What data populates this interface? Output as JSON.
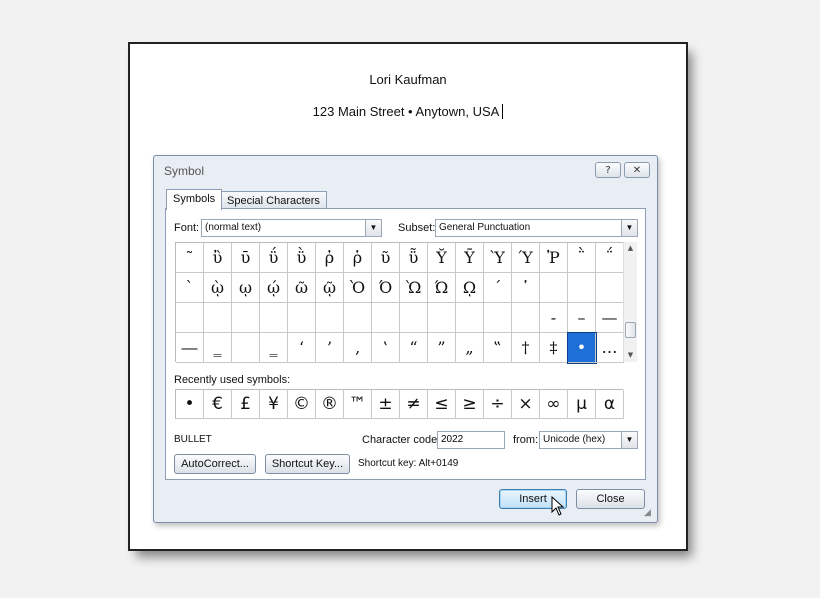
{
  "document": {
    "line1": "Lori Kaufman",
    "line2": "123 Main Street • Anytown, USA"
  },
  "dialog": {
    "title": "Symbol",
    "help_btn": "?",
    "close_btn": "✕",
    "tabs": [
      {
        "label": "Symbols",
        "active": true
      },
      {
        "label": "Special Characters",
        "active": false
      }
    ],
    "font_label": "Font:",
    "font_value": "(normal text)",
    "subset_label": "Subset:",
    "subset_value": "General Punctuation",
    "grid_rows": [
      [
        "῀",
        "ὒ",
        "ῡ",
        "ΰ",
        "ῢ",
        "ῤ",
        "ῥ",
        "ῦ",
        "ῧ",
        "Ῠ",
        "Ῡ",
        "Ὺ",
        "Ύ",
        "Ῥ",
        "῭",
        "΅",
        ""
      ],
      [
        "`",
        "ῲ",
        "ῳ",
        "ῴ",
        "ῶ",
        "ῷ",
        "Ὸ",
        "Ό",
        "Ὼ",
        "Ώ",
        "ῼ",
        "´",
        "῾",
        "",
        "",
        "",
        ""
      ],
      [
        "",
        "",
        "",
        "",
        "",
        "",
        "",
        "",
        "",
        "",
        "",
        "",
        "",
        "‐",
        "–",
        "—",
        ""
      ],
      [
        "―",
        "‗",
        "",
        "‗",
        "‘",
        "’",
        "‚",
        "‛",
        "“",
        "”",
        "„",
        "‟",
        "†",
        "‡",
        "•",
        "…",
        ""
      ]
    ],
    "selected_symbol": "•",
    "recent_label": "Recently used symbols:",
    "recent_symbols": [
      "•",
      "€",
      "£",
      "¥",
      "©",
      "®",
      "™",
      "±",
      "≠",
      "≤",
      "≥",
      "÷",
      "×",
      "∞",
      "µ",
      "α"
    ],
    "char_name": "BULLET",
    "char_code_label": "Character code:",
    "char_code_value": "2022",
    "from_label": "from:",
    "from_value": "Unicode (hex)",
    "autocorrect_btn": "AutoCorrect...",
    "shortcut_key_btn": "Shortcut Key...",
    "shortcut_text": "Shortcut key: Alt+0149",
    "insert_btn": "Insert",
    "close_label": "Close"
  }
}
